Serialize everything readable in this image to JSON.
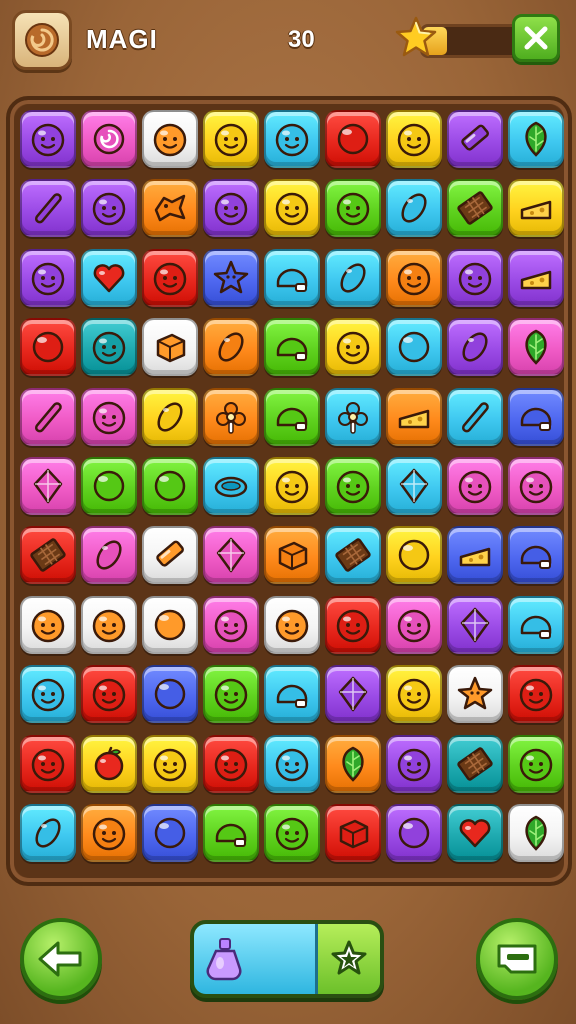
{
  "header": {
    "title": "MAGI",
    "score": "30",
    "star_progress": 0.25,
    "home_icon": "swirl-cookie-icon",
    "star_icon": "star-icon",
    "close_icon": "close-x-icon"
  },
  "board": {
    "rows": 11,
    "cols": 9,
    "tiles": [
      [
        "purple",
        "smile"
      ],
      [
        "pink",
        "swirl"
      ],
      [
        "white",
        "smile"
      ],
      [
        "yellow",
        "smile"
      ],
      [
        "cyan",
        "smile"
      ],
      [
        "red",
        "circle"
      ],
      [
        "yellow",
        "smile"
      ],
      [
        "purple",
        "bar"
      ],
      [
        "cyan",
        "leaf"
      ],
      [
        "purple",
        "stick"
      ],
      [
        "purple",
        "smile"
      ],
      [
        "orange",
        "bird"
      ],
      [
        "purple",
        "smile"
      ],
      [
        "yellow",
        "smile"
      ],
      [
        "green",
        "smile"
      ],
      [
        "cyan",
        "oval"
      ],
      [
        "green",
        "choco"
      ],
      [
        "yellow",
        "cheese"
      ],
      [
        "purple",
        "smile"
      ],
      [
        "cyan",
        "heart"
      ],
      [
        "red",
        "smile"
      ],
      [
        "blue",
        "star"
      ],
      [
        "cyan",
        "cap"
      ],
      [
        "cyan",
        "oval"
      ],
      [
        "orange",
        "smile"
      ],
      [
        "purple",
        "smile"
      ],
      [
        "purple",
        "cheese"
      ],
      [
        "red",
        "circle"
      ],
      [
        "teal",
        "smile"
      ],
      [
        "white",
        "box"
      ],
      [
        "orange",
        "oval"
      ],
      [
        "green",
        "cap"
      ],
      [
        "yellow",
        "smile"
      ],
      [
        "cyan",
        "circle"
      ],
      [
        "purple",
        "oval"
      ],
      [
        "pink",
        "leaf"
      ],
      [
        "pink",
        "stick"
      ],
      [
        "pink",
        "smile"
      ],
      [
        "yellow",
        "oval"
      ],
      [
        "orange",
        "flower"
      ],
      [
        "green",
        "cap"
      ],
      [
        "cyan",
        "flower"
      ],
      [
        "orange",
        "cheese"
      ],
      [
        "cyan",
        "stick"
      ],
      [
        "blue",
        "cap"
      ],
      [
        "pink",
        "gem"
      ],
      [
        "green",
        "circle"
      ],
      [
        "green",
        "circle"
      ],
      [
        "cyan",
        "ring"
      ],
      [
        "yellow",
        "smile"
      ],
      [
        "green",
        "smile"
      ],
      [
        "cyan",
        "gem"
      ],
      [
        "pink",
        "smile"
      ],
      [
        "pink",
        "smile"
      ],
      [
        "red",
        "choco"
      ],
      [
        "pink",
        "oval"
      ],
      [
        "white",
        "bar"
      ],
      [
        "pink",
        "gem"
      ],
      [
        "orange",
        "box"
      ],
      [
        "cyan",
        "choco"
      ],
      [
        "yellow",
        "circle"
      ],
      [
        "blue",
        "cheese"
      ],
      [
        "blue",
        "cap"
      ],
      [
        "white",
        "smile"
      ],
      [
        "white",
        "smile"
      ],
      [
        "white",
        "circle"
      ],
      [
        "pink",
        "smile"
      ],
      [
        "white",
        "smile"
      ],
      [
        "red",
        "smile"
      ],
      [
        "pink",
        "smile"
      ],
      [
        "purple",
        "gem"
      ],
      [
        "cyan",
        "cap"
      ],
      [
        "cyan",
        "smile"
      ],
      [
        "red",
        "smile"
      ],
      [
        "blue",
        "circle"
      ],
      [
        "green",
        "smile"
      ],
      [
        "cyan",
        "cap"
      ],
      [
        "purple",
        "gem"
      ],
      [
        "yellow",
        "smile"
      ],
      [
        "white",
        "star"
      ],
      [
        "red",
        "smile"
      ],
      [
        "red",
        "smile"
      ],
      [
        "yellow",
        "apple"
      ],
      [
        "yellow",
        "smile"
      ],
      [
        "red",
        "smile"
      ],
      [
        "cyan",
        "smile"
      ],
      [
        "orange",
        "leaf"
      ],
      [
        "purple",
        "smile"
      ],
      [
        "teal",
        "choco"
      ],
      [
        "green",
        "smile"
      ],
      [
        "cyan",
        "oval"
      ],
      [
        "orange",
        "smile"
      ],
      [
        "blue",
        "circle"
      ],
      [
        "green",
        "cap"
      ],
      [
        "green",
        "smile"
      ],
      [
        "red",
        "box"
      ],
      [
        "purple",
        "circle"
      ],
      [
        "teal",
        "heart"
      ],
      [
        "white",
        "leaf"
      ]
    ]
  },
  "palette": {
    "purple": "#9b4be6",
    "pink": "#f05bc6",
    "white": "#f4f4f4",
    "yellow": "#ffd21e",
    "cyan": "#3fc8f0",
    "red": "#e8281e",
    "orange": "#ff8a1c",
    "green": "#5fd21f",
    "blue": "#4f68f0",
    "teal": "#1faab0"
  },
  "footer": {
    "back_icon": "arrow-left-icon",
    "booster_icon": "potion-icon",
    "booster_star_icon": "star-outline-icon",
    "menu_icon": "card-icon"
  }
}
